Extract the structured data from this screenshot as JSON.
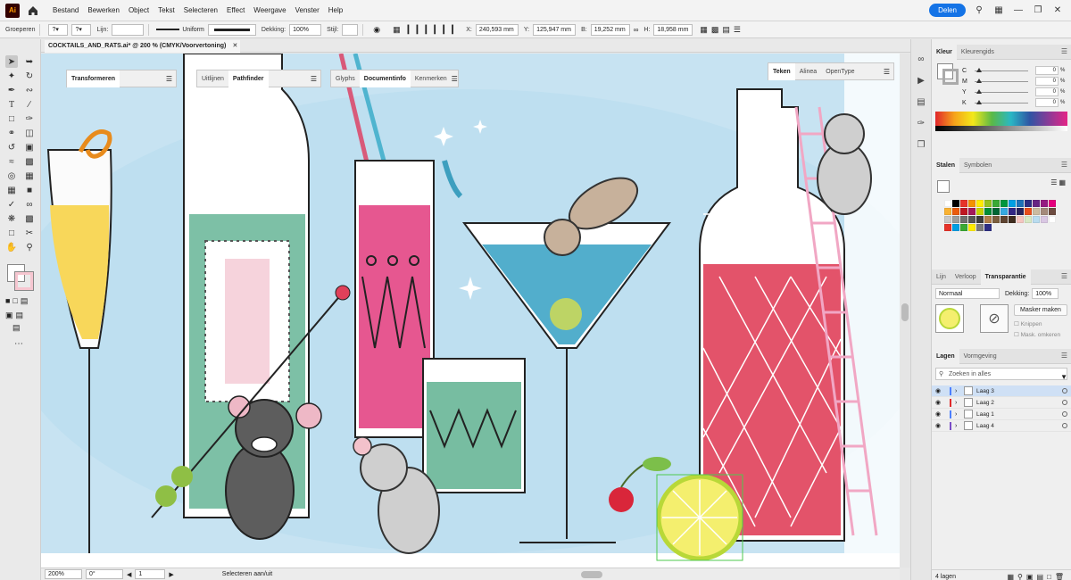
{
  "menubar": {
    "logo": "Ai",
    "items": [
      "Bestand",
      "Bewerken",
      "Object",
      "Tekst",
      "Selecteren",
      "Effect",
      "Weergave",
      "Venster",
      "Help"
    ],
    "share_label": "Delen"
  },
  "controlbar": {
    "selection": "Groeperen",
    "stroke_label": "Lijn:",
    "stroke_profile": "Uniform",
    "opacity_label": "Dekking:",
    "opacity_value": "100%",
    "style_label": "Stijl:",
    "x_label": "X:",
    "x_value": "240,593 mm",
    "y_label": "Y:",
    "y_value": "125,947 mm",
    "w_label": "B:",
    "w_value": "19,252 mm",
    "h_label": "H:",
    "h_value": "18,958 mm"
  },
  "document": {
    "tab_title": "COCKTAILS_AND_RATS.ai* @ 200 % (CMYK/Voorvertoning)"
  },
  "floating_panels": {
    "transform": {
      "tabs": [
        "Transformeren"
      ]
    },
    "align": {
      "tabs": [
        "Uitlijnen",
        "Pathfinder"
      ],
      "active": "Pathfinder"
    },
    "docinfo": {
      "tabs": [
        "Glyphs",
        "Documentinfo",
        "Kenmerken"
      ],
      "active": "Documentinfo"
    },
    "character": {
      "tabs": [
        "Teken",
        "Alinea",
        "OpenType"
      ],
      "active": "Teken"
    }
  },
  "statusbar": {
    "zoom": "200%",
    "rotation": "0°",
    "artboard": "1",
    "status_text": "Selecteren aan/uit"
  },
  "color_panel": {
    "tabs": [
      "Kleur",
      "Kleurengids"
    ],
    "channels": [
      {
        "label": "C",
        "value": "0"
      },
      {
        "label": "M",
        "value": "0"
      },
      {
        "label": "Y",
        "value": "0"
      },
      {
        "label": "K",
        "value": "0"
      }
    ],
    "unit": "%"
  },
  "swatches_panel": {
    "tabs": [
      "Stalen",
      "Symbolen"
    ],
    "colors": [
      "#ffffff",
      "#000000",
      "#e6332a",
      "#f39200",
      "#ffed00",
      "#95c11f",
      "#3aaa35",
      "#00963f",
      "#009fe3",
      "#1d71b8",
      "#2d2e83",
      "#662483",
      "#951b81",
      "#e5007d",
      "#f9b233",
      "#ea5b0c",
      "#be1622",
      "#a3195b",
      "#c7d300",
      "#008d36",
      "#006633",
      "#36a9e1",
      "#312783",
      "#29235c",
      "#e94e1b",
      "#cbbba0",
      "#a48a7b",
      "#6d4c41",
      "#c9c9c9",
      "#9d9d9c",
      "#706f6f",
      "#575756",
      "#3c3c3b",
      "#b17f4a",
      "#7b5e3d",
      "#5d4330",
      "#3e2c1e",
      "#f5c6c0",
      "#d7e8c4",
      "#b9dcef",
      "#d9c7e3",
      "#ffffff",
      "#e6332a",
      "#009fe3",
      "#3aaa35",
      "#ffed00",
      "#7d7d7d",
      "#2d2e83"
    ]
  },
  "transparency_panel": {
    "tabs": [
      "Lijn",
      "Verloop",
      "Transparantie"
    ],
    "active": "Transparantie",
    "blend_mode": "Normaal",
    "opacity_label": "Dekking:",
    "opacity_value": "100%",
    "mask_button": "Masker maken",
    "clip_label": "Knippen",
    "invert_label": "Mask. omkeren"
  },
  "layers_panel": {
    "tabs": [
      "Lagen",
      "Vormgeving"
    ],
    "search_placeholder": "Zoeken in alles",
    "layers": [
      {
        "name": "Laag 3",
        "color": "#4c7fff",
        "selected": true
      },
      {
        "name": "Laag 2",
        "color": "#e02a2a",
        "selected": false
      },
      {
        "name": "Laag 1",
        "color": "#4c7fff",
        "selected": false
      },
      {
        "name": "Laag 4",
        "color": "#7a4cc7",
        "selected": false
      }
    ],
    "footer_count": "4 lagen"
  }
}
